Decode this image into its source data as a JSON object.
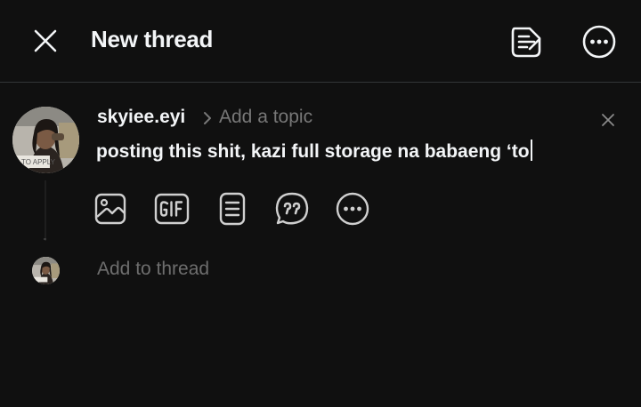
{
  "header": {
    "title": "New thread",
    "close_icon": "close-icon",
    "drafts_icon": "drafts-icon",
    "more_icon": "more-options-icon"
  },
  "composer": {
    "username": "skyiee.eyi",
    "topic_placeholder": "Add a topic",
    "post_text": "posting this shit, kazi full storage na babaeng ‘to",
    "avatar_badge_text": "TO APPLY",
    "toolbar": [
      "image-icon",
      "gif-icon",
      "poll-list-icon",
      "quote-icon",
      "more-icon"
    ]
  },
  "add_thread": {
    "label": "Add to thread"
  },
  "colors": {
    "background": "#101010",
    "text_primary": "#f3f5f7",
    "text_secondary": "#777777",
    "icon": "#d0d0d0"
  }
}
